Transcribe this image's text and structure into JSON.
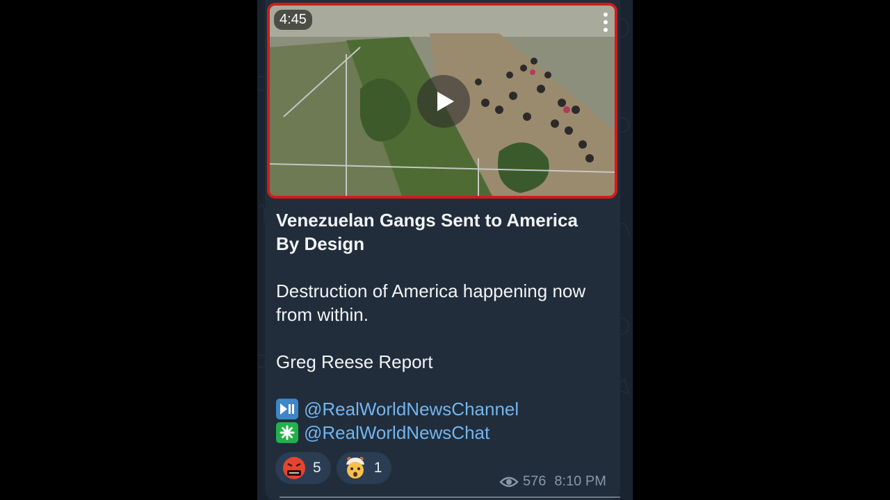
{
  "post": {
    "video": {
      "duration": "4:45",
      "play_icon": "play-icon",
      "menu_icon": "more-vertical-icon",
      "border_color": "#d21b1b"
    },
    "title": "Venezuelan Gangs Sent to America By Design",
    "paragraph1": "Destruction of America happening now from within.",
    "paragraph2": "Greg Reese Report",
    "links": [
      {
        "icon": "play-pause-emoji",
        "text": "@RealWorldNewsChannel"
      },
      {
        "icon": "eight-spoked-asterisk-emoji",
        "text": "@RealWorldNewsChat"
      }
    ],
    "link_color": "#72b5f0",
    "reactions": [
      {
        "icon": "cursing-face-emoji",
        "count": "5"
      },
      {
        "icon": "exploding-head-emoji",
        "count": "1"
      }
    ],
    "views": "576",
    "time": "8:10 PM"
  }
}
